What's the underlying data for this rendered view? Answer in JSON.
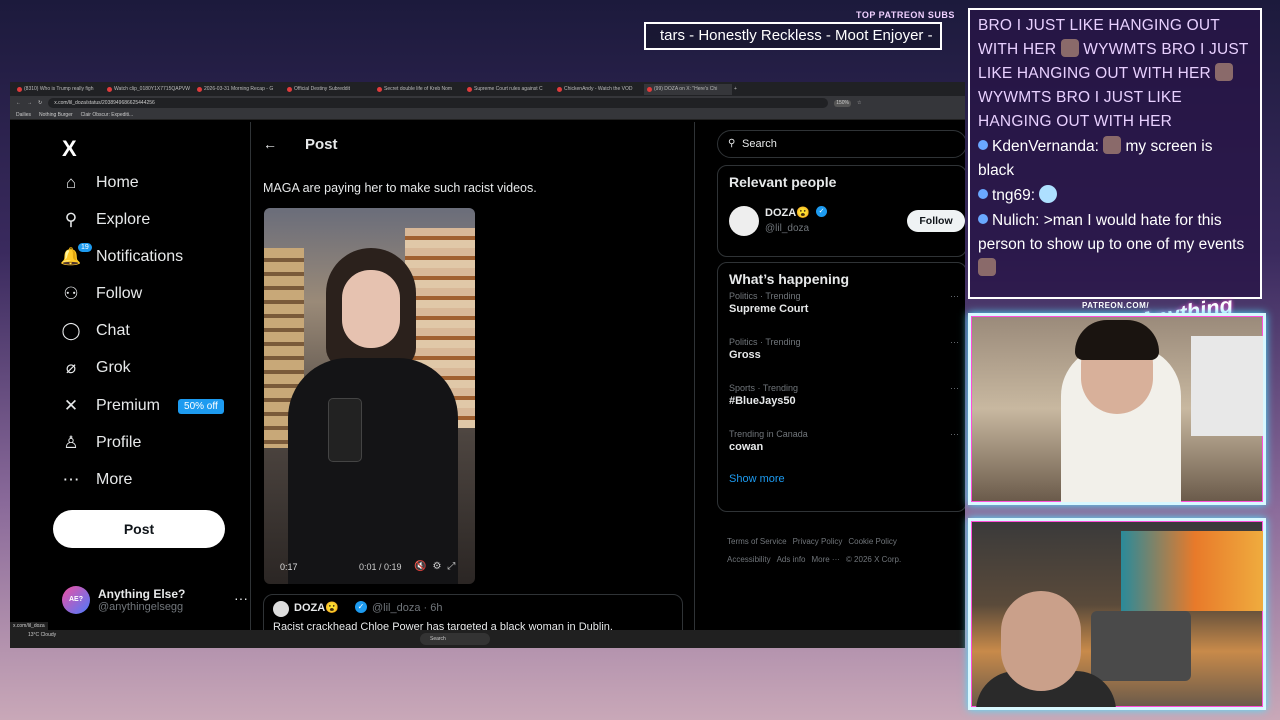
{
  "overlay": {
    "top_label": "TOP PATREON SUBS",
    "ticker_text": "tars - Honestly Reckless - Moot Enjoyer - ",
    "patreon_url": "PATREON.COM/",
    "brand": "Anything Else?"
  },
  "browser": {
    "tabs": [
      {
        "label": "(8310) Who is Trump really figh"
      },
      {
        "label": "Watch clip_0180Y1X7715QAPVW"
      },
      {
        "label": "2026-03-31 Morning Recap - G"
      },
      {
        "label": "Official Destiny Subreddit"
      },
      {
        "label": "Secret double life of Kreb Nom"
      },
      {
        "label": "Supreme Court rules against C"
      },
      {
        "label": "ChickenAndy - Watch the VOD"
      },
      {
        "label": "(99) DOZA on X: \"Here's Chi"
      }
    ],
    "url": "x.com/lil_doza/status/2038949686625444256",
    "zoom": "150%",
    "bookmarks": [
      "Dailies",
      "Nothing Burger",
      "Clair Obscur: Expediti..."
    ]
  },
  "nav": {
    "logo": "X",
    "items": [
      {
        "label": "Home",
        "icon": "home-icon",
        "glyph": "⌂"
      },
      {
        "label": "Explore",
        "icon": "search-icon",
        "glyph": "⚲"
      },
      {
        "label": "Notifications",
        "icon": "bell-icon",
        "glyph": "🔔"
      },
      {
        "label": "Follow",
        "icon": "person-add-icon",
        "glyph": "⚇"
      },
      {
        "label": "Chat",
        "icon": "chat-icon",
        "glyph": "◯"
      },
      {
        "label": "Grok",
        "icon": "grok-icon",
        "glyph": "⌀"
      },
      {
        "label": "Premium",
        "icon": "x-icon",
        "glyph": "✕"
      },
      {
        "label": "Profile",
        "icon": "person-icon",
        "glyph": "♙"
      },
      {
        "label": "More",
        "icon": "more-icon",
        "glyph": "⋯"
      }
    ],
    "notification_count": "19",
    "premium_badge": "50% off",
    "post_button": "Post",
    "account": {
      "name": "Anything Else?",
      "handle": "@anythingelsegg",
      "avatar_text": "AE?",
      "more": "···"
    }
  },
  "post": {
    "back": "←",
    "title": "Post",
    "text": "MAGA are paying her to make such racist videos.",
    "video": {
      "current_time": "0:17",
      "duration": "0:01 / 0:19"
    },
    "quote": {
      "name": "DOZA😮",
      "handle": "@lil_doza · 6h",
      "text": "Racist crackhead Chloe Power has targeted a black woman in Dublin."
    }
  },
  "right": {
    "search_placeholder": "Search",
    "relevant_title": "Relevant people",
    "relevant": {
      "name": "DOZA😮",
      "handle": "@lil_doza",
      "follow": "Follow"
    },
    "happening_title": "What’s happening",
    "trends": [
      {
        "category": "Politics · Trending",
        "name": "Supreme Court"
      },
      {
        "category": "Politics · Trending",
        "name": "Gross"
      },
      {
        "category": "Sports · Trending",
        "name": "#BlueJays50"
      },
      {
        "category": "Trending in Canada",
        "name": "cowan"
      }
    ],
    "show_more": "Show more",
    "footer": [
      "Terms of Service",
      "Privacy Policy",
      "Cookie Policy",
      "Accessibility",
      "Ads info",
      "More ···",
      "© 2026 X Corp."
    ]
  },
  "taskbar": {
    "search": "Search",
    "weather_temp": "13°C",
    "weather_desc": "Cloudy",
    "status_url": "x.com/lil_doza"
  },
  "chat": {
    "caps_message": "BRO I JUST LIKE HANGING OUT WITH HER",
    "emote_text": "WYWMTS",
    "messages": [
      {
        "user": "KdenVernanda:",
        "text": "my screen is black"
      },
      {
        "user": "tng69:",
        "text": ""
      },
      {
        "user": "Nulich:",
        "text": ">man I would hate for this person to show up to one of my events"
      }
    ]
  },
  "colors": {
    "accent": "#1d9bf0",
    "x_bg": "#000000",
    "chat_border": "#ffffff",
    "cam_glow": "#4fe0ff"
  }
}
